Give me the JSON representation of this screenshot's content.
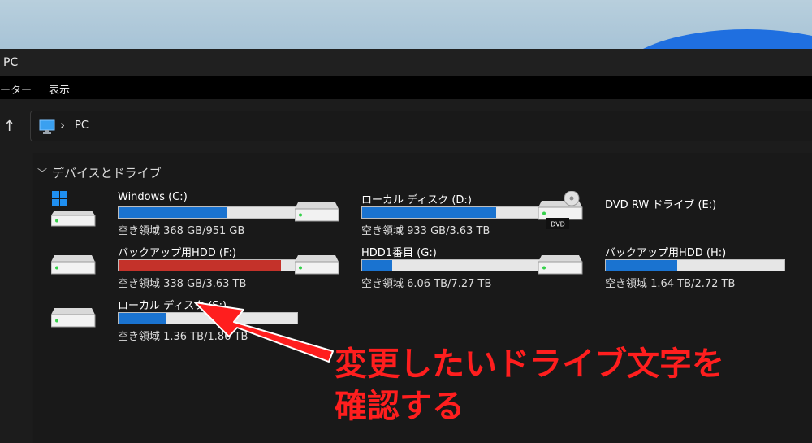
{
  "window": {
    "title": "PC"
  },
  "menu": {
    "item_computer": "ーター",
    "item_view": "表示"
  },
  "address": {
    "crumb": "PC",
    "separator": "›"
  },
  "section": {
    "title": "デバイスとドライブ"
  },
  "drives": [
    {
      "name": "Windows (C:)",
      "size": "空き領域 368 GB/951 GB",
      "used_fraction": 0.61
    },
    {
      "name": "ローカル ディスク (D:)",
      "size": "空き領域 933 GB/3.63 TB",
      "used_fraction": 0.75
    },
    {
      "name": "DVD RW ドライブ (E:)",
      "badge": "DVD"
    },
    {
      "name": "バックアップ用HDD (F:)",
      "size": "空き領域 338 GB/3.63 TB",
      "used_fraction": 0.91
    },
    {
      "name": "HDD1番目 (G:)",
      "size": "空き領域 6.06 TB/7.27 TB",
      "used_fraction": 0.17
    },
    {
      "name": "バックアップ用HDD (H:)",
      "size": "空き領域 1.64 TB/2.72 TB",
      "used_fraction": 0.4
    },
    {
      "name": "ローカル ディスク (S:)",
      "size": "空き領域 1.36 TB/1.86 TB",
      "used_fraction": 0.27
    }
  ],
  "annotation": {
    "line1": "変更したいドライブ文字を",
    "line2": "確認する"
  },
  "colors": {
    "bar_blue": "#1a73d0",
    "bar_red": "#c4322a",
    "annotation_red": "#ff1e1e"
  },
  "icons": {
    "pc": "monitor-icon",
    "drive": "hard-drive-icon",
    "dvd": "dvd-drive-icon",
    "windows": "windows-logo-icon"
  }
}
